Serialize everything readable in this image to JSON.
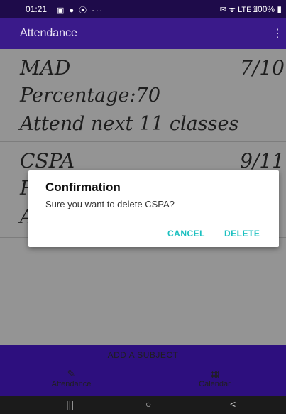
{
  "status_bar": {
    "time": "01:21",
    "left_icons": "▣ ● ⦿ ···",
    "right_icons": "✉ ᯤ LTE ıl",
    "battery": "100% ▮"
  },
  "app_bar": {
    "title": "Attendance",
    "menu_icon": "⋮"
  },
  "subjects": [
    {
      "name": "MAD",
      "count": "7/10",
      "percentage": "Percentage:70",
      "advice": "Attend next 11 classes"
    },
    {
      "name": "CSPA",
      "count": "9/11",
      "percentage": "P",
      "advice": "A"
    }
  ],
  "dialog": {
    "title": "Confirmation",
    "message": "Sure you want to delete CSPA?",
    "cancel": "CANCEL",
    "delete": "DELETE"
  },
  "bottom": {
    "add_subject": "ADD A SUBJECT",
    "nav": [
      {
        "label": "Attendance",
        "icon": "✎"
      },
      {
        "label": "Calendar",
        "icon": "▦"
      }
    ]
  },
  "system_nav": {
    "recents": "|||",
    "home": "○",
    "back": "<"
  }
}
